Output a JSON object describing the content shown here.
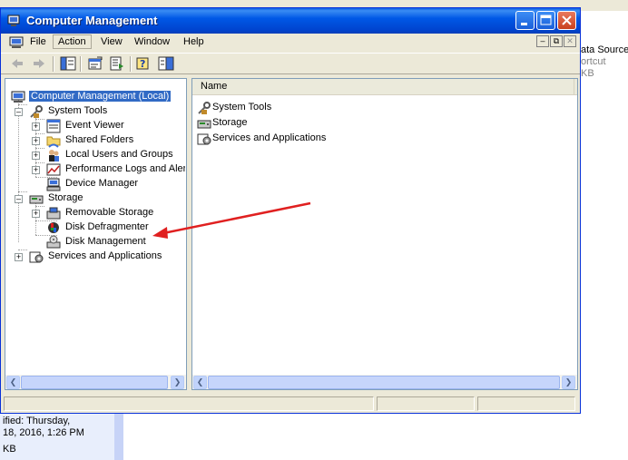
{
  "background": {
    "right_texts": [
      "ata Sources",
      "ortcut",
      "KB"
    ],
    "bottom_left_texts": [
      "ified: Thursday,",
      "18, 2016, 1:26 PM",
      "KB"
    ]
  },
  "window": {
    "title": "Computer Management",
    "controls": {
      "minimize": "minimize",
      "maximize": "maximize",
      "close": "close"
    }
  },
  "menu": {
    "items": [
      "File",
      "Action",
      "View",
      "Window",
      "Help"
    ],
    "active": "Action"
  },
  "toolbar": {
    "icons": [
      "back-arrow-icon",
      "forward-arrow-icon",
      "show-hide-console-tree-icon",
      "properties-icon",
      "export-list-icon",
      "help-icon",
      "action-pane-icon"
    ]
  },
  "tree": {
    "root": "Computer Management (Local)",
    "system_tools": "System Tools",
    "event_viewer": "Event Viewer",
    "shared_folders": "Shared Folders",
    "local_users": "Local Users and Groups",
    "perf_logs": "Performance Logs and Alerts",
    "device_manager": "Device Manager",
    "storage": "Storage",
    "removable_storage": "Removable Storage",
    "disk_defrag": "Disk Defragmenter",
    "disk_management": "Disk Management",
    "services": "Services and Applications"
  },
  "list": {
    "column": "Name",
    "items": [
      "System Tools",
      "Storage",
      "Services and Applications"
    ]
  },
  "annotation": {
    "arrow_color": "#e02020"
  },
  "colors": {
    "titlebar": "#0054e3",
    "selection": "#316ac5",
    "chrome": "#ece9d8"
  }
}
